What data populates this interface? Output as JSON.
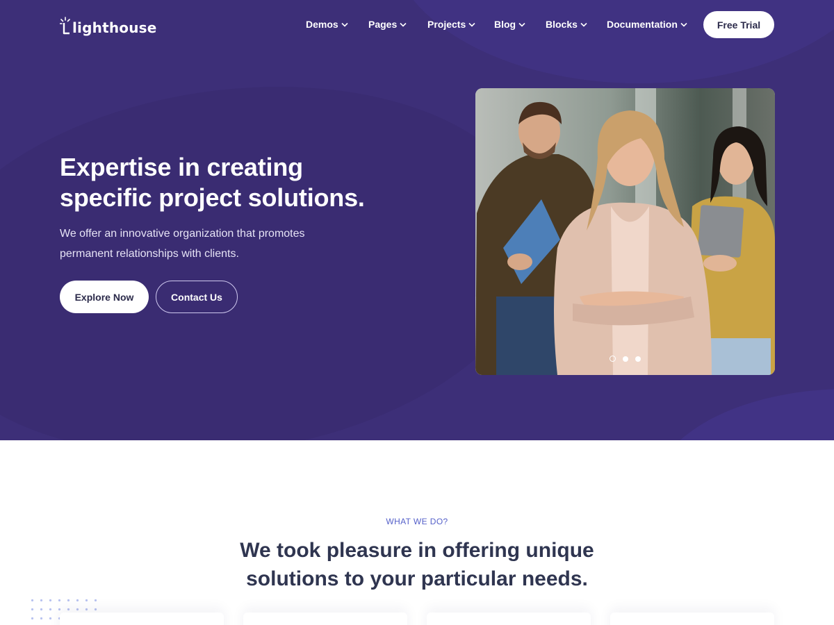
{
  "brand": {
    "name": "lighthouse",
    "accent": "#3d2f78",
    "link_color": "#5560c9"
  },
  "nav": {
    "items": [
      {
        "label": "Demos"
      },
      {
        "label": "Pages"
      },
      {
        "label": "Projects"
      },
      {
        "label": "Blog"
      },
      {
        "label": "Blocks"
      },
      {
        "label": "Documentation"
      }
    ],
    "cta_label": "Free Trial"
  },
  "hero": {
    "title_line1": "Expertise in creating",
    "title_line2": "specific project solutions.",
    "subtitle_line1": "We offer an innovative organization that promotes",
    "subtitle_line2": "permanent relationships with clients.",
    "primary_button": "Explore Now",
    "secondary_button": "Contact Us",
    "slider": {
      "count": 3,
      "active_index": 0
    }
  },
  "what_we_do": {
    "eyebrow": "WHAT WE DO?",
    "title_line1": "We took pleasure in offering unique",
    "title_line2": "solutions to your particular needs."
  }
}
